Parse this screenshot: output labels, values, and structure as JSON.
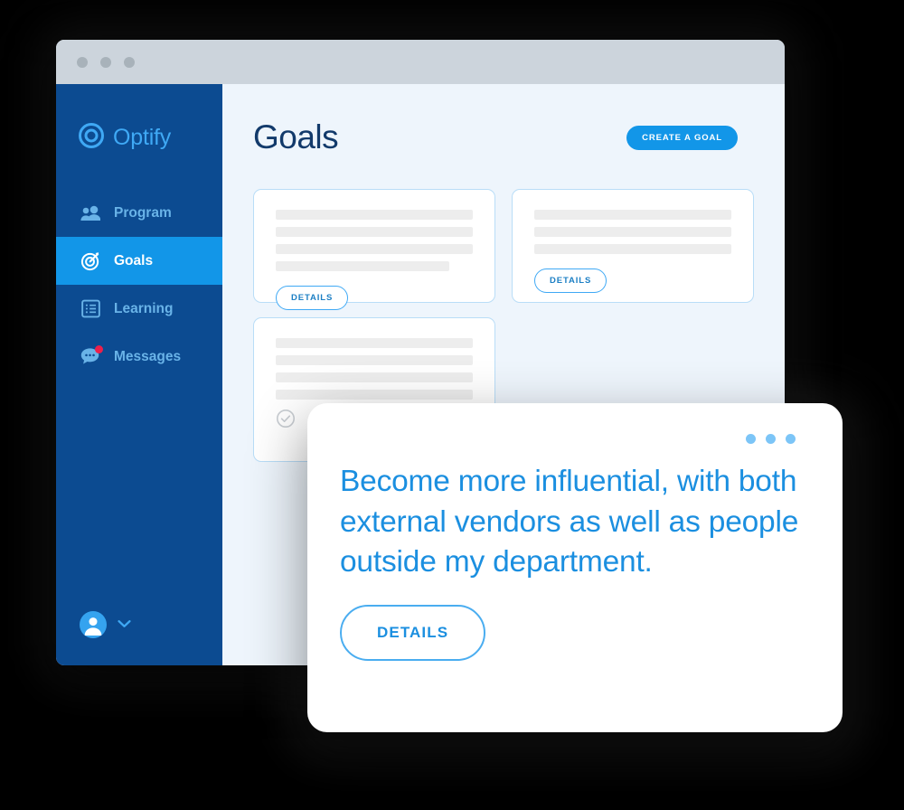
{
  "window": {
    "titlebar_dots": 3
  },
  "sidebar": {
    "brand": {
      "name": "Optify",
      "logo_icon": "optify-ring-logo-icon"
    },
    "items": [
      {
        "label": "Program",
        "icon": "people-icon",
        "active": false,
        "badge": false
      },
      {
        "label": "Goals",
        "icon": "target-icon",
        "active": true,
        "badge": false
      },
      {
        "label": "Learning",
        "icon": "list-icon",
        "active": false,
        "badge": false
      },
      {
        "label": "Messages",
        "icon": "chat-bubble-icon",
        "active": false,
        "badge": true
      }
    ],
    "user": {
      "avatar_icon": "user-avatar-icon",
      "chevron_icon": "chevron-down-icon"
    },
    "colors": {
      "background": "#0c4b91",
      "active_background": "#1296e8",
      "label": "#69b3e8",
      "active_label": "#ffffff",
      "badge": "#ec1f4b"
    }
  },
  "main": {
    "title": "Goals",
    "create_button_label": "CREATE A GOAL",
    "cards": [
      {
        "skeleton_widths": [
          "100%",
          "100%",
          "100%",
          "88%"
        ],
        "details_label": "DETAILS",
        "has_check": false
      },
      {
        "skeleton_widths": [
          "100%",
          "100%",
          "100%"
        ],
        "details_label": "DETAILS",
        "has_check": false
      },
      {
        "skeleton_widths": [
          "100%",
          "100%",
          "100%",
          "100%"
        ],
        "details_label": "",
        "has_check": true
      }
    ],
    "colors": {
      "background": "#eef5fc",
      "title": "#123a6b",
      "accent": "#1296e8",
      "card_border": "#b9ddf7",
      "skeleton": "#ededed"
    }
  },
  "modal": {
    "dots": 3,
    "goal_text": "Become more influential, with both external vendors as well as people outside my department.",
    "details_label": "DETAILS",
    "colors": {
      "text": "#1b8fe0",
      "dots": "#7cc5f7",
      "button_border": "#4aadf0"
    }
  }
}
